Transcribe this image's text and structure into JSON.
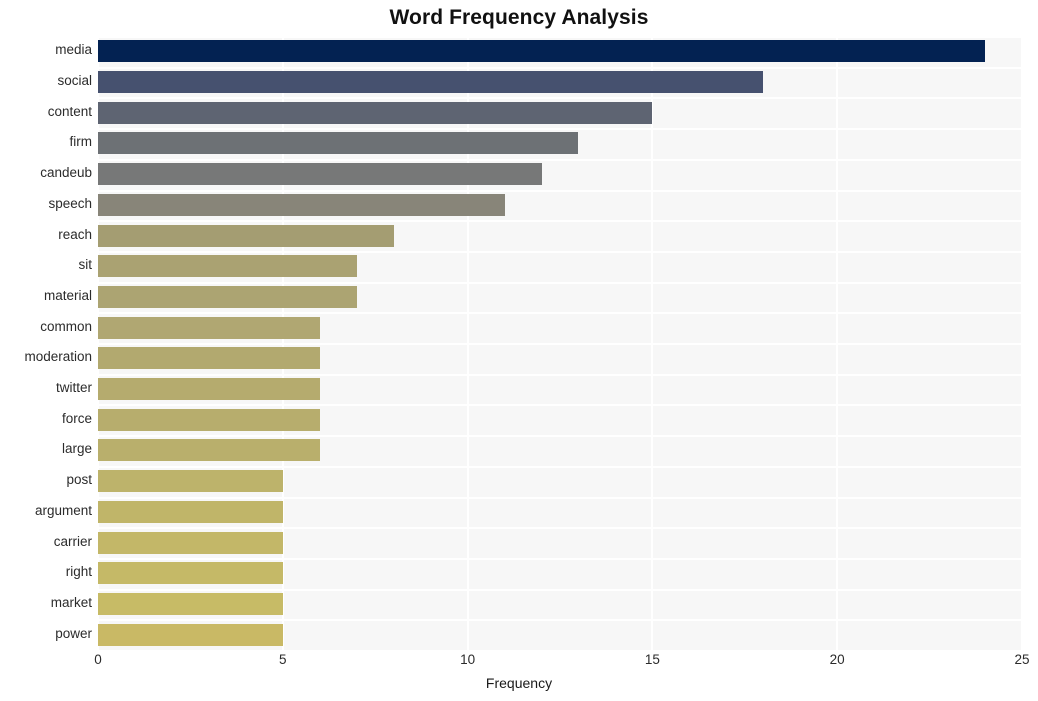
{
  "chart_data": {
    "type": "bar",
    "orientation": "horizontal",
    "title": "Word Frequency Analysis",
    "xlabel": "Frequency",
    "ylabel": "",
    "xlim": [
      0,
      25
    ],
    "xticks": [
      0,
      5,
      10,
      15,
      20,
      25
    ],
    "xtick_labels": [
      "0",
      "5",
      "10",
      "15",
      "20",
      "25"
    ],
    "grid": true,
    "grid_color": "#ffffff",
    "plot_background": "#f7f7f7",
    "legend": null,
    "categories": [
      "media",
      "social",
      "content",
      "firm",
      "candeub",
      "speech",
      "reach",
      "sit",
      "material",
      "common",
      "moderation",
      "twitter",
      "force",
      "large",
      "post",
      "argument",
      "carrier",
      "right",
      "market",
      "power"
    ],
    "values": [
      24,
      18,
      15,
      13,
      12,
      11,
      8,
      7,
      7,
      6,
      6,
      6,
      6,
      6,
      5,
      5,
      5,
      5,
      5,
      5
    ],
    "bar_colors": [
      "#032252",
      "#46516f",
      "#5e6472",
      "#6d7175",
      "#777878",
      "#888579",
      "#a49d72",
      "#aaa272",
      "#aca472",
      "#b0a772",
      "#b2a96f",
      "#b5ab6e",
      "#b7ad6d",
      "#b9af6c",
      "#bdb36b",
      "#c0b569",
      "#c3b768",
      "#c5b967",
      "#c7bb66",
      "#c9b965"
    ]
  }
}
